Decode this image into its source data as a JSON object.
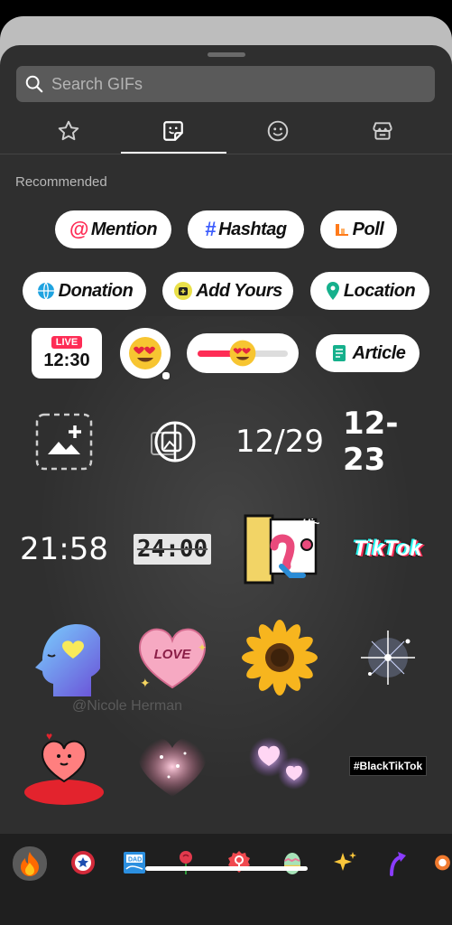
{
  "search": {
    "placeholder": "Search GIFs"
  },
  "tabs": [
    {
      "name": "favorites",
      "icon": "star-icon"
    },
    {
      "name": "stickers",
      "icon": "sticker-icon"
    },
    {
      "name": "emoji",
      "icon": "smiley-icon"
    },
    {
      "name": "store",
      "icon": "store-icon"
    }
  ],
  "section": {
    "title": "Recommended"
  },
  "stickers": {
    "mention": "Mention",
    "hashtag": "Hashtag",
    "poll": "Poll",
    "donation": "Donation",
    "add_yours": "Add Yours",
    "location": "Location",
    "live_badge": "LIVE",
    "live_time": "12:30",
    "article": "Article",
    "date_slash": "12/29",
    "date_dash": "12-23",
    "clock": "21:58",
    "flip_clock": "24:00",
    "hi": "Hi~",
    "tiktok_logo": "TikTok",
    "love": "LOVE",
    "black_tiktok": "#BlackTikTok"
  },
  "watermark": "@Nicole Herman",
  "bottom_icons": [
    "fire-icon",
    "badge-icon",
    "dad-card-icon",
    "rose-icon",
    "female-sign-icon",
    "easter-egg-icon",
    "sparkles-icon",
    "arrow-icon",
    "partial-icon"
  ],
  "colors": {
    "sheet": "#2f2f2f",
    "accent": "#fe2c55",
    "cyan": "#25f4ee"
  }
}
